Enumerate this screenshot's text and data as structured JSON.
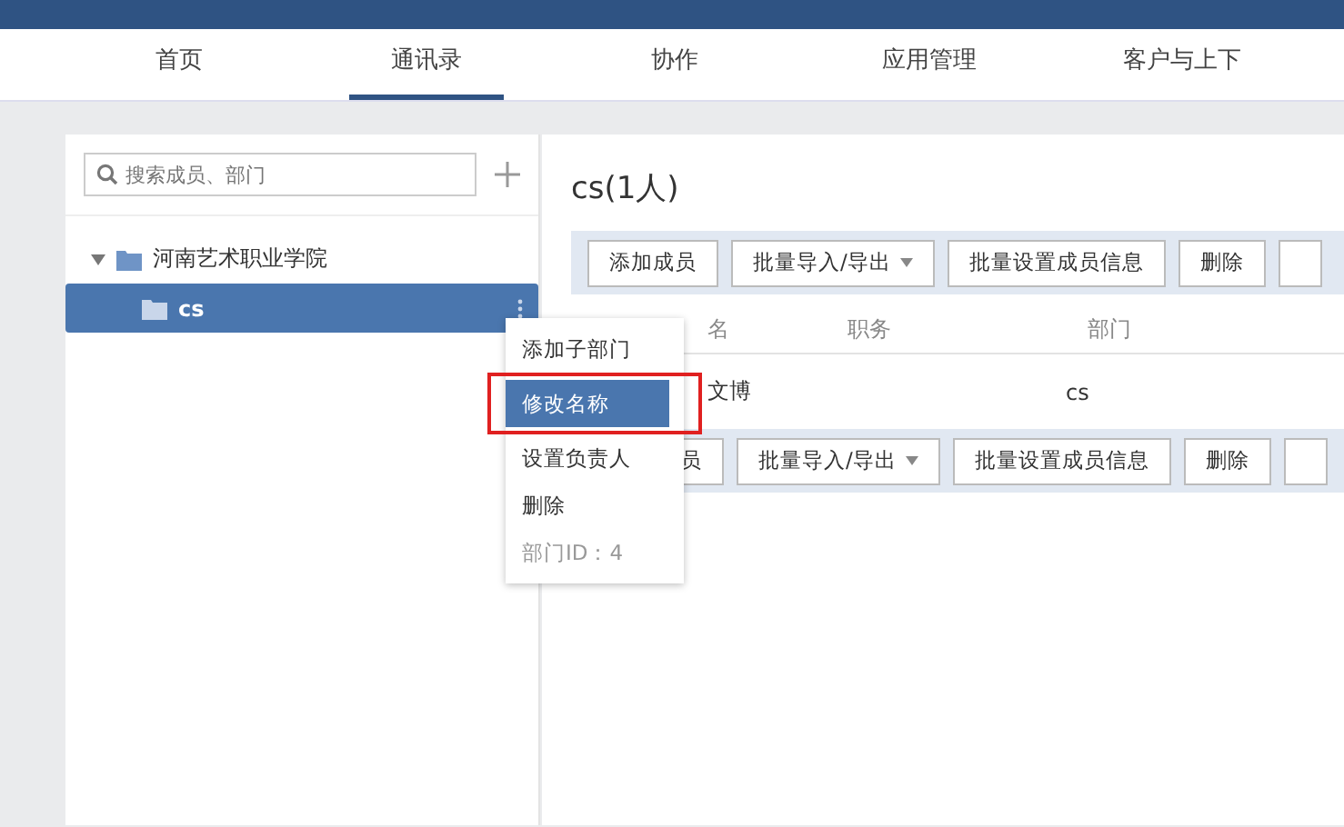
{
  "tabs": [
    {
      "label": "首页",
      "selected": false
    },
    {
      "label": "通讯录",
      "selected": true
    },
    {
      "label": "协作",
      "selected": false
    },
    {
      "label": "应用管理",
      "selected": false
    },
    {
      "label": "客户与上下",
      "selected": false
    }
  ],
  "search": {
    "placeholder": "搜索成员、部门"
  },
  "tree": [
    {
      "label": "河南艺术职业学院",
      "expanded": true,
      "selected": false,
      "children": [
        {
          "label": "cs",
          "selected": true
        }
      ]
    }
  ],
  "department": {
    "title": "cs(1人)"
  },
  "toolbar_top": [
    {
      "label": "添加成员",
      "dropdown": false
    },
    {
      "label": "批量导入/导出",
      "dropdown": true
    },
    {
      "label": "批量设置成员信息",
      "dropdown": false
    },
    {
      "label": "删除",
      "dropdown": false
    }
  ],
  "table": {
    "columns": [
      "名",
      "职务",
      "部门"
    ],
    "rows": [
      {
        "name": "文博",
        "department": "cs"
      }
    ]
  },
  "toolbar_bottom": [
    {
      "label": "员",
      "dropdown": false
    },
    {
      "label": "批量导入/导出",
      "dropdown": true
    },
    {
      "label": "批量设置成员信息",
      "dropdown": false
    },
    {
      "label": "删除",
      "dropdown": false
    }
  ],
  "context_menu": [
    {
      "label": "添加子部门",
      "kind": "action",
      "selected": false
    },
    {
      "label": "修改名称",
      "kind": "action",
      "selected": true
    },
    {
      "label": "设置负责人",
      "kind": "action",
      "selected": false
    },
    {
      "label": "删除",
      "kind": "action",
      "selected": false
    },
    {
      "label": "部门ID：4",
      "kind": "info",
      "selected": false
    }
  ]
}
